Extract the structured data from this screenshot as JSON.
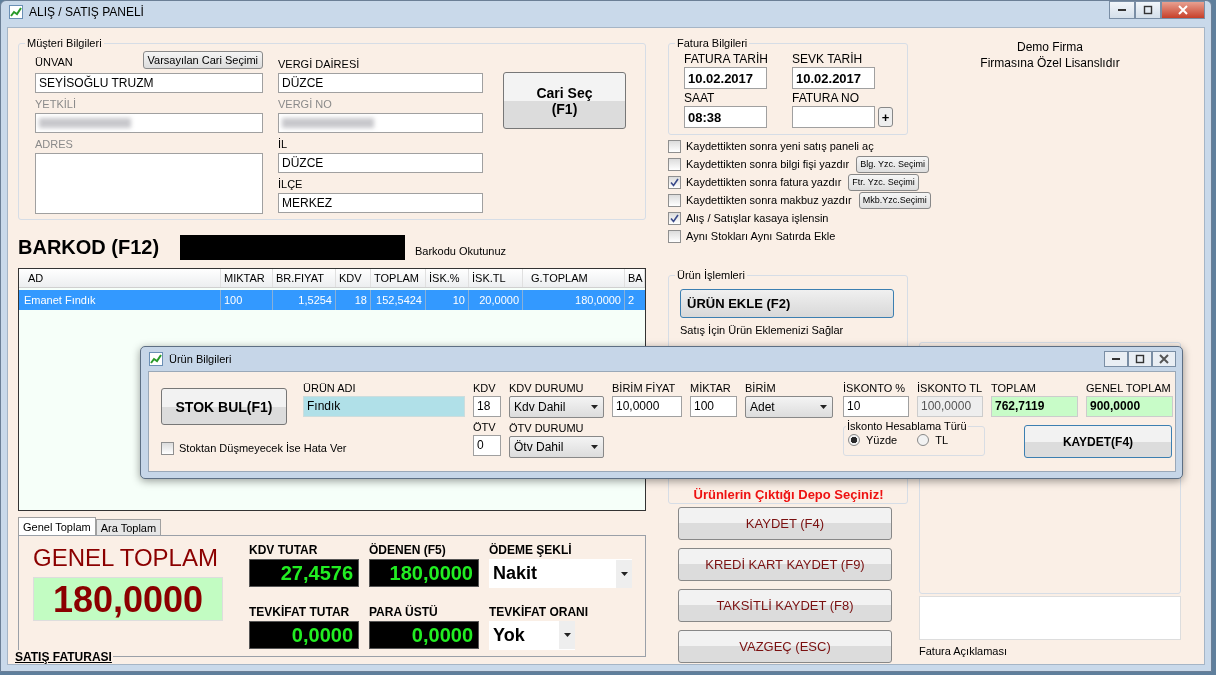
{
  "window": {
    "title": "ALIŞ / SATIŞ PANELİ"
  },
  "customer": {
    "title": "Müşteri Bilgileri",
    "default_button": "Varsayılan Cari Seçimi",
    "select_button": "Cari Seç\n(F1)",
    "left_fields": [
      {
        "label": "ÜNVAN",
        "value": "SEYİSOĞLU TRUZM",
        "disabled": false
      },
      {
        "label": "YETKİLİ",
        "disabled": true,
        "blurred": true
      },
      {
        "label": "ADRES",
        "disabled": true,
        "kind": "multiline"
      }
    ],
    "right_fields": [
      {
        "label": "VERGİ DAİRESİ",
        "value": "DÜZCE",
        "disabled": false
      },
      {
        "label": "VERGİ NO",
        "disabled": true,
        "blurred": true
      },
      {
        "label": "İL",
        "value": "DÜZCE",
        "disabled": false
      },
      {
        "label": "İLÇE",
        "value": "MERKEZ",
        "disabled": false
      }
    ]
  },
  "barcode": {
    "label": "BARKOD (F12)",
    "hint": "Barkodu Okutunuz"
  },
  "table": {
    "columns": [
      "AD",
      "MIKTAR",
      "BR.FIYAT",
      "KDV",
      "TOPLAM",
      "İSK.%",
      "İSK.TL",
      "G.TOPLAM",
      "BA"
    ],
    "rows": [
      {
        "selected": true,
        "cells": [
          "Emanet Fındık",
          "100",
          "1,5254",
          "18",
          "152,5424",
          "10",
          "20,0000",
          "180,0000",
          "2"
        ]
      }
    ]
  },
  "tabs": [
    {
      "label": "Genel Toplam",
      "selected": true
    },
    {
      "label": "Ara Toplam",
      "selected": false
    }
  ],
  "totals": {
    "title": "GENEL TOPLAM",
    "value": "180,0000",
    "fields": [
      {
        "label": "KDV TUTAR",
        "value": "27,4576",
        "kind": "display"
      },
      {
        "label": "ÖDENEN (F5)",
        "value": "180,0000",
        "kind": "display"
      },
      {
        "label": "ÖDEME ŞEKLİ",
        "value": "Nakit",
        "kind": "dropdown"
      },
      {
        "label": "TEVKİFAT TUTAR",
        "value": "0,0000",
        "kind": "display"
      },
      {
        "label": "PARA ÜSTÜ",
        "value": "0,0000",
        "kind": "display"
      },
      {
        "label": "TEVKİFAT ORANI",
        "value": "Yok",
        "kind": "dropdown"
      }
    ]
  },
  "document_type": "SATIŞ FATURASI",
  "invoice": {
    "title": "Fatura Bilgileri",
    "fields": [
      {
        "label": "FATURA TARİH",
        "value": "10.02.2017"
      },
      {
        "label": "SEVK TARİH",
        "value": "10.02.2017"
      },
      {
        "label": "SAAT",
        "value": "08:38"
      },
      {
        "label": "FATURA NO"
      }
    ],
    "add_button": "+"
  },
  "options": [
    {
      "label": "Kaydettikten sonra yeni satış paneli aç",
      "checked": false
    },
    {
      "label": "Kaydettikten sonra bilgi fişi yazdır",
      "checked": false,
      "button": "Blg. Yzc. Seçimi"
    },
    {
      "label": "Kaydettikten sonra fatura yazdır",
      "checked": true,
      "button": "Ftr. Yzc. Seçimi"
    },
    {
      "label": "Kaydettikten sonra makbuz yazdır",
      "checked": false,
      "button": "Mkb.Yzc.Seçimi"
    },
    {
      "label": "Alış / Satışlar kasaya işlensin",
      "checked": true
    },
    {
      "label": "Aynı Stokları Aynı Satırda Ekle",
      "checked": false
    }
  ],
  "product_ops": {
    "title": "Ürün İşlemleri",
    "add_button": "ÜRÜN EKLE (F2)",
    "hint": "Satış İçin Ürün Eklemenizi Sağlar",
    "warning": "Ürünlerin Çıktığı Depo Seçiniz!"
  },
  "actions": [
    "KAYDET (F4)",
    "KREDİ KART KAYDET (F9)",
    "TAKSİTLİ KAYDET (F8)",
    "VAZGEÇ (ESC)"
  ],
  "license": [
    "Demo Firma",
    "Firmasına Özel Lisanslıdır"
  ],
  "notes": {
    "label": "Fatura Açıklaması"
  },
  "dialog": {
    "title": "Ürün Bilgileri",
    "stock_button": "STOK BUL(F1)",
    "stock_check": {
      "label": "Stoktan Düşmeyecek İse Hata Ver",
      "checked": false
    },
    "product_name": {
      "label": "ÜRÜN ADI",
      "value": "Fındık"
    },
    "kdv": {
      "label": "KDV",
      "value": "18"
    },
    "otv": {
      "label": "ÖTV",
      "value": "0"
    },
    "kdv_status": {
      "label": "KDV DURUMU",
      "value": "Kdv Dahil"
    },
    "otv_status": {
      "label": "ÖTV DURUMU",
      "value": "Ötv Dahil"
    },
    "unit_price": {
      "label": "BİRİM FİYAT",
      "value": "10,0000"
    },
    "quantity": {
      "label": "MİKTAR",
      "value": "100"
    },
    "unit": {
      "label": "BİRİM",
      "value": "Adet"
    },
    "discount_pct": {
      "label": "İSKONTO %",
      "value": "10"
    },
    "discount_tl": {
      "label": "İSKONTO TL",
      "value": "100,0000",
      "disabled": true
    },
    "discount_mode": {
      "title": "İskonto Hesablama Türü",
      "options": [
        {
          "label": "Yüzde",
          "selected": true
        },
        {
          "label": "TL",
          "selected": false
        }
      ]
    },
    "total": {
      "label": "TOPLAM",
      "value": "762,7119"
    },
    "grand_total": {
      "label": "GENEL TOPLAM",
      "value": "900,0000"
    },
    "save_button": "KAYDET(F4)"
  }
}
